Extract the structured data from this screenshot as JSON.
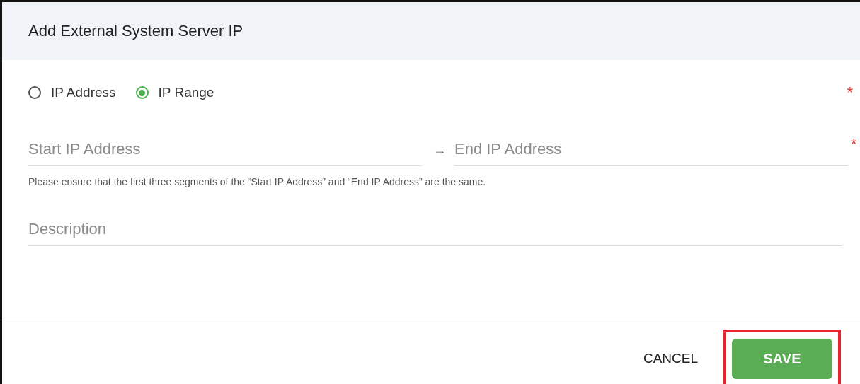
{
  "dialog": {
    "title": "Add External System Server IP"
  },
  "mode": {
    "required_mark": "*",
    "options": [
      {
        "label": "IP Address",
        "selected": false
      },
      {
        "label": "IP Range",
        "selected": true
      }
    ]
  },
  "range": {
    "start": {
      "placeholder": "Start IP Address"
    },
    "separator": "→",
    "end": {
      "placeholder": "End IP Address"
    },
    "required_mark": "*",
    "hint": "Please ensure that the first three segments of the “Start IP Address” and “End IP Address” are the same."
  },
  "description": {
    "placeholder": "Description"
  },
  "buttons": [
    {
      "label": "CANCEL",
      "kind": "text",
      "highlighted": false
    },
    {
      "label": "SAVE",
      "kind": "primary",
      "highlighted": true
    }
  ]
}
